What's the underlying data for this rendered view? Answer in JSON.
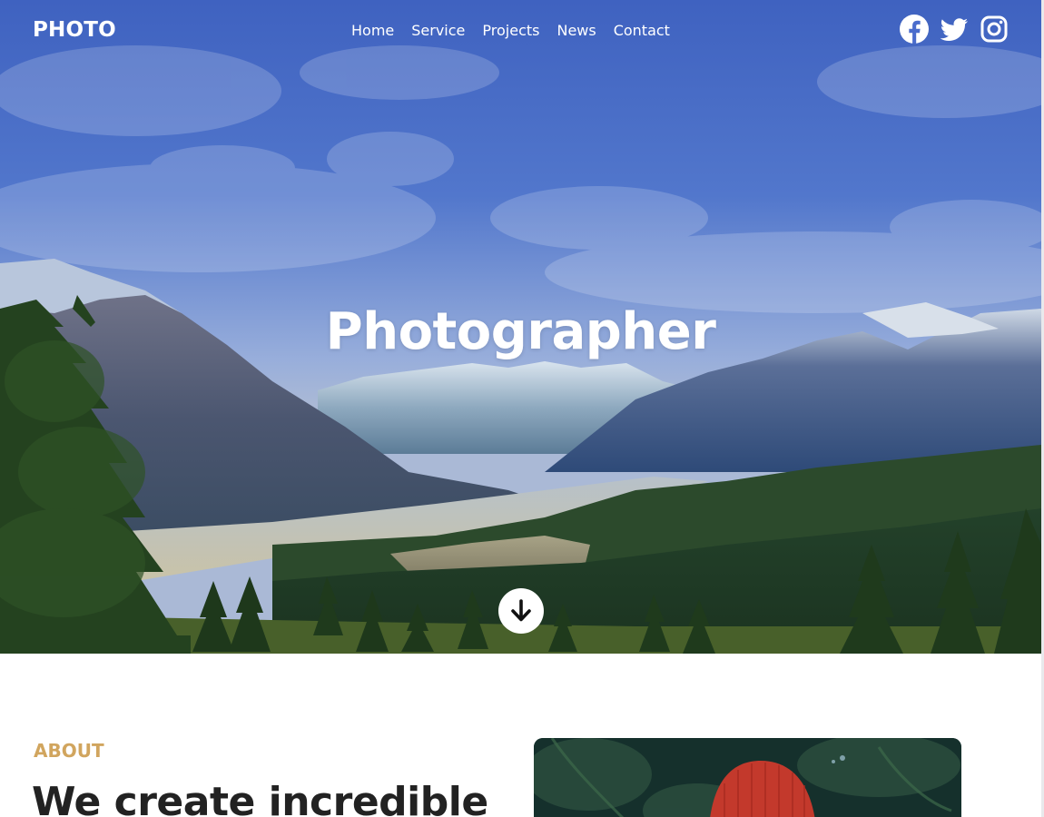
{
  "nav": {
    "logo": "PHOTO",
    "links": [
      {
        "label": "Home"
      },
      {
        "label": "Service"
      },
      {
        "label": "Projects"
      },
      {
        "label": "News"
      },
      {
        "label": "Contact"
      }
    ],
    "social": [
      {
        "icon": "facebook-icon"
      },
      {
        "icon": "twitter-icon"
      },
      {
        "icon": "instagram-icon"
      }
    ]
  },
  "hero": {
    "title": "Photographer",
    "scroll_icon": "arrow-down-circle-icon"
  },
  "about": {
    "label": "ABOUT",
    "heading": "We create incredible"
  },
  "colors": {
    "accent": "#d1a55e",
    "heading_text": "#222222",
    "nav_text": "#ffffff"
  }
}
